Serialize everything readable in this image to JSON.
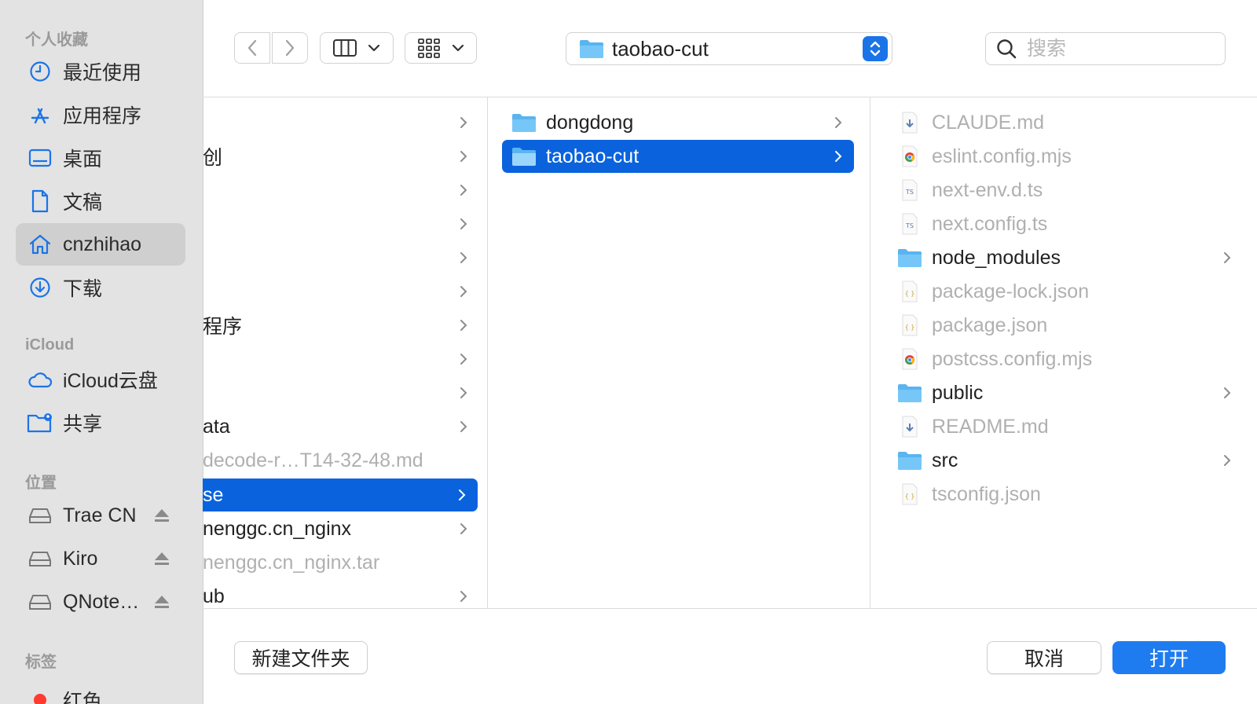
{
  "sidebar": {
    "favorites_header": "个人收藏",
    "favorites": [
      {
        "label": "最近使用",
        "icon": "clock-icon"
      },
      {
        "label": "应用程序",
        "icon": "applications-icon"
      },
      {
        "label": "桌面",
        "icon": "desktop-icon"
      },
      {
        "label": "文稿",
        "icon": "document-icon"
      },
      {
        "label": "cnzhihao",
        "icon": "home-icon",
        "selected": true
      },
      {
        "label": "下载",
        "icon": "download-icon"
      }
    ],
    "icloud_header": "iCloud",
    "icloud": [
      {
        "label": "iCloud云盘",
        "icon": "cloud-icon"
      },
      {
        "label": "共享",
        "icon": "shared-folder-icon"
      }
    ],
    "locations_header": "位置",
    "locations": [
      {
        "label": "Trae CN",
        "icon": "drive-icon"
      },
      {
        "label": "Kiro",
        "icon": "drive-icon"
      },
      {
        "label": "QNote…",
        "icon": "drive-icon"
      }
    ],
    "tags_header": "标签",
    "tags": [
      {
        "label": "红色",
        "color": "#ff3b30"
      }
    ]
  },
  "toolbar": {
    "path_label": "taobao-cut",
    "search_placeholder": "搜索"
  },
  "columns": {
    "col1": [
      {
        "name": "",
        "dim": false
      },
      {
        "name": "创",
        "dim": false
      },
      {
        "name": "",
        "dim": false
      },
      {
        "name": "",
        "dim": false
      },
      {
        "name": "",
        "dim": false
      },
      {
        "name": "",
        "dim": false
      },
      {
        "name": "程序",
        "dim": false
      },
      {
        "name": "",
        "dim": false
      },
      {
        "name": "",
        "dim": false
      },
      {
        "name": "ata",
        "dim": false
      },
      {
        "name": "decode-r…T14-32-48.md",
        "dim": true
      },
      {
        "name": "se",
        "dim": false,
        "selected": true
      },
      {
        "name": "nenggc.cn_nginx",
        "dim": false
      },
      {
        "name": "nenggc.cn_nginx.tar",
        "dim": true
      },
      {
        "name": "ub",
        "dim": false
      }
    ],
    "col2": [
      {
        "name": "dongdong",
        "type": "folder"
      },
      {
        "name": "taobao-cut",
        "type": "folder",
        "selected": true
      }
    ],
    "col3": [
      {
        "name": "CLAUDE.md",
        "type": "md",
        "dim": true
      },
      {
        "name": "eslint.config.mjs",
        "type": "mjs",
        "dim": true
      },
      {
        "name": "next-env.d.ts",
        "type": "ts",
        "dim": true
      },
      {
        "name": "next.config.ts",
        "type": "ts",
        "dim": true
      },
      {
        "name": "node_modules",
        "type": "folder",
        "dim": false
      },
      {
        "name": "package-lock.json",
        "type": "json",
        "dim": true
      },
      {
        "name": "package.json",
        "type": "json",
        "dim": true
      },
      {
        "name": "postcss.config.mjs",
        "type": "mjs",
        "dim": true
      },
      {
        "name": "public",
        "type": "folder",
        "dim": false
      },
      {
        "name": "README.md",
        "type": "md",
        "dim": true
      },
      {
        "name": "src",
        "type": "folder",
        "dim": false
      },
      {
        "name": "tsconfig.json",
        "type": "json",
        "dim": true
      }
    ]
  },
  "footer": {
    "new_folder": "新建文件夹",
    "cancel": "取消",
    "open": "打开"
  },
  "colors": {
    "accent": "#0a63dd",
    "primary_button": "#1f7cf0",
    "sidebar_bg": "#e3e3e3"
  }
}
